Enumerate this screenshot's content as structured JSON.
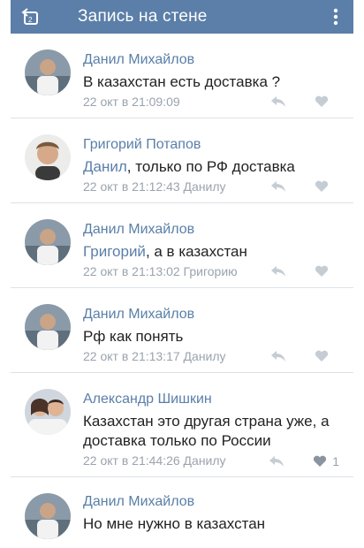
{
  "header": {
    "title": "Запись на стене"
  },
  "comments": [
    {
      "author": "Данил Михайлов",
      "mention": "",
      "text": "В казахстан есть доставка ?",
      "time": "22 окт в 21:09:09",
      "reply_to": "",
      "likes": ""
    },
    {
      "author": "Григорий Потапов",
      "mention": "Данил",
      "text": ", только по РФ доставка",
      "time": "22 окт в 21:12:43",
      "reply_to": "Данилу",
      "likes": ""
    },
    {
      "author": "Данил Михайлов",
      "mention": "Григорий",
      "text": ", а в казахстан",
      "time": "22 окт в 21:13:02",
      "reply_to": "Григорию",
      "likes": ""
    },
    {
      "author": "Данил Михайлов",
      "mention": "",
      "text": "Рф как понять",
      "time": "22 окт в 21:13:17",
      "reply_to": "Данилу",
      "likes": ""
    },
    {
      "author": "Александр Шишкин",
      "mention": "",
      "text": "Казахстан это другая страна уже, а доставка только по России",
      "time": "22 окт в 21:44:26",
      "reply_to": "Данилу",
      "likes": "1"
    },
    {
      "author": "Данил Михайлов",
      "mention": "",
      "text": "Но мне нужно в казахстан",
      "time": "",
      "reply_to": "",
      "likes": ""
    }
  ],
  "colors": {
    "header": "#5b7fa8",
    "link": "#5a7fa8",
    "meta": "#9aa3ad"
  },
  "icons": {
    "back": "back-arrow-icon",
    "menu": "more-vertical-icon",
    "reply": "reply-icon",
    "like": "heart-icon"
  }
}
